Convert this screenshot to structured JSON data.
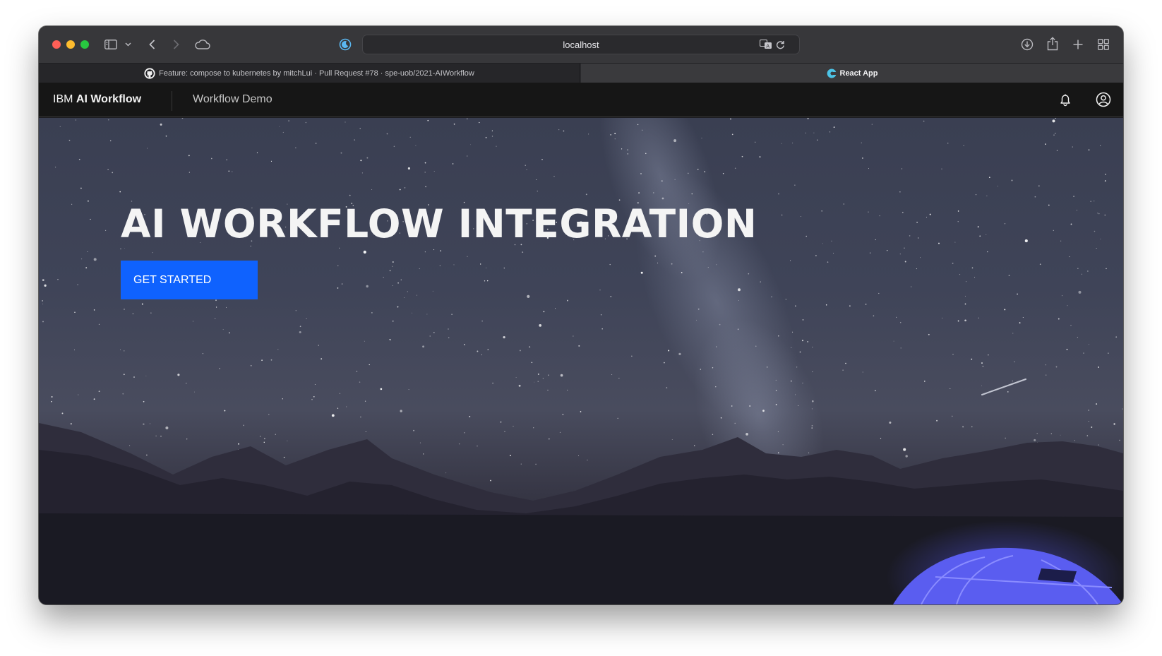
{
  "browser": {
    "address": "localhost",
    "tabs": [
      {
        "label": "Feature: compose to kubernetes by mitchLui · Pull Request #78 · spe-uob/2021-AIWorkflow",
        "favicon": "github-icon",
        "active": false
      },
      {
        "label": "React App",
        "favicon": "react-app-icon",
        "active": true
      }
    ],
    "icons": [
      "sidebar-icon",
      "chevron-down-icon",
      "back-arrow-icon",
      "forward-arrow-icon",
      "cloud-icon",
      "night-shift-icon",
      "translate-icon",
      "reload-icon",
      "download-icon",
      "share-icon",
      "new-tab-plus-icon",
      "tab-overview-icon"
    ]
  },
  "header": {
    "brand_prefix": "IBM",
    "brand_name": "AI Workflow",
    "nav_item": "Workflow Demo",
    "actions": [
      "notification-icon",
      "user-avatar-icon"
    ]
  },
  "hero": {
    "title": "AI WORKFLOW INTEGRATION",
    "cta_label": "GET STARTED",
    "cta_color": "#0f62fe"
  },
  "colors": {
    "header_bg": "#161616",
    "accent": "#0f62fe",
    "text_primary": "#f4f4f4"
  }
}
